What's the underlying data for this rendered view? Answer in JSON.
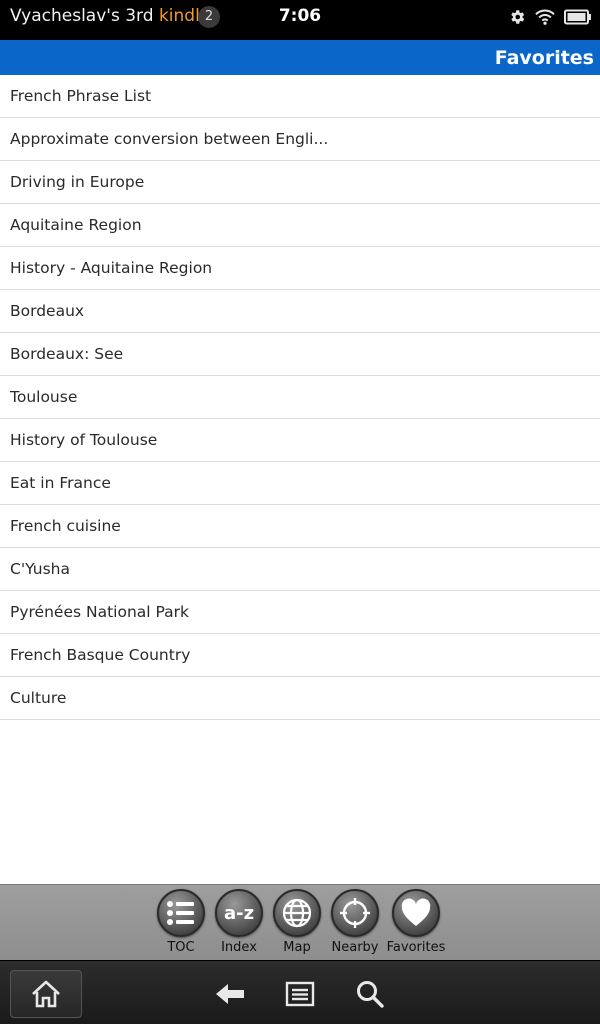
{
  "status_bar": {
    "owner_prefix": "Vyacheslav's 3rd ",
    "owner_brand": "kindle",
    "notification_count": "2",
    "time": "7:06",
    "icons": [
      "gear-icon",
      "wifi-icon",
      "battery-icon"
    ]
  },
  "header": {
    "title": "Favorites"
  },
  "favorites": [
    "French Phrase List",
    "Approximate conversion between Engli...",
    "Driving in Europe",
    "Aquitaine Region",
    "History - Aquitaine Region",
    "Bordeaux",
    "Bordeaux: See",
    "Toulouse",
    "History of Toulouse",
    "Eat in France",
    "French cuisine",
    "C'Yusha",
    "Pyrénées National Park",
    "French Basque Country",
    "Culture"
  ],
  "toolbar": {
    "toc_label": "TOC",
    "index_label": "Index",
    "index_icon_text": "a-z",
    "map_label": "Map",
    "nearby_label": "Nearby",
    "favorites_label": "Favorites"
  },
  "nav": {
    "icons": [
      "home-icon",
      "back-icon",
      "menu-icon",
      "search-icon"
    ]
  },
  "colors": {
    "header_blue": "#0a66c8",
    "brand_orange": "#f39a2b",
    "status_bg": "#000000",
    "toolbar_gray": "#9e9e9e"
  }
}
